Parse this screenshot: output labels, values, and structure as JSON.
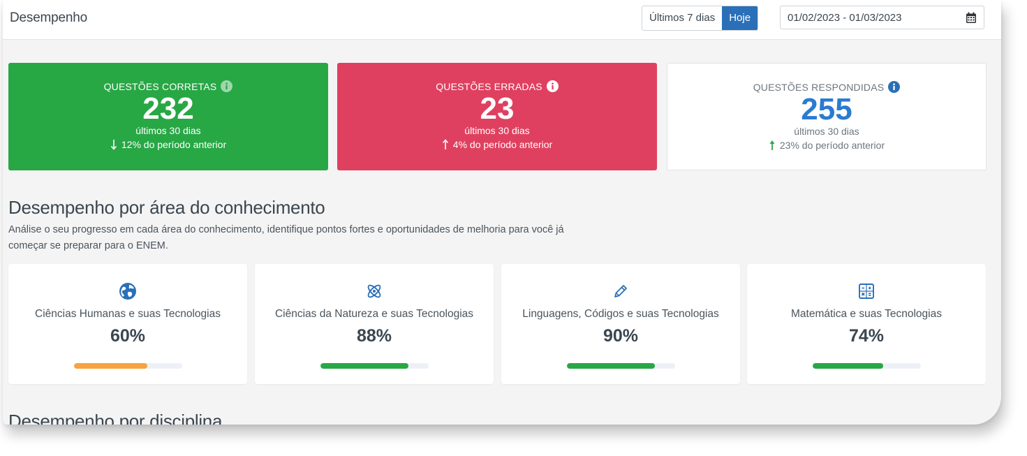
{
  "header": {
    "title": "Desempenho",
    "range_options": [
      "Últimos 7 dias",
      "Hoje"
    ],
    "active_range": "Hoje",
    "date_range": "01/02/2023 - 01/03/2023"
  },
  "stats": [
    {
      "label": "QUESTÕES CORRETAS",
      "value": "232",
      "period": "últimos 30 dias",
      "change": "12% do período anterior",
      "direction": "down",
      "color": "#28a745"
    },
    {
      "label": "QUESTÕES ERRADAS",
      "value": "23",
      "period": "últimos 30 dias",
      "change": "4% do período anterior",
      "direction": "up",
      "color": "#e0405f"
    },
    {
      "label": "QUESTÕES RESPONDIDAS",
      "value": "255",
      "period": "últimos 30 dias",
      "change": "23% do período anterior",
      "direction": "up",
      "color": "#ffffff"
    }
  ],
  "areas_section": {
    "title": "Desempenho por área do conhecimento",
    "description": "Análise o seu progresso em cada área do conhecimento, identifique pontos fortes e oportunidades de melhoria para você já começar se preparar para o ENEM."
  },
  "areas": [
    {
      "name": "Ciências Humanas e suas Tecnologias",
      "percent": "60%",
      "progress": 0.68,
      "icon": "globe-icon",
      "bar_color": "#f7a340"
    },
    {
      "name": "Ciências da Natureza e suas Tecnologias",
      "percent": "88%",
      "progress": 0.81,
      "icon": "atom-icon",
      "bar_color": "#28a745"
    },
    {
      "name": "Linguagens, Códigos e suas Tecnologias",
      "percent": "90%",
      "progress": 0.81,
      "icon": "pencil-icon",
      "bar_color": "#28a745"
    },
    {
      "name": "Matemática e suas Tecnologias",
      "percent": "74%",
      "progress": 0.65,
      "icon": "calculator-icon",
      "bar_color": "#28a745"
    }
  ],
  "discipline_section": {
    "title": "Desempenho por disciplina"
  },
  "colors": {
    "primary": "#2a6fb8",
    "accent_blue": "#2a7bd0",
    "success": "#28a745",
    "danger": "#e0405f",
    "warning": "#f7a340"
  }
}
